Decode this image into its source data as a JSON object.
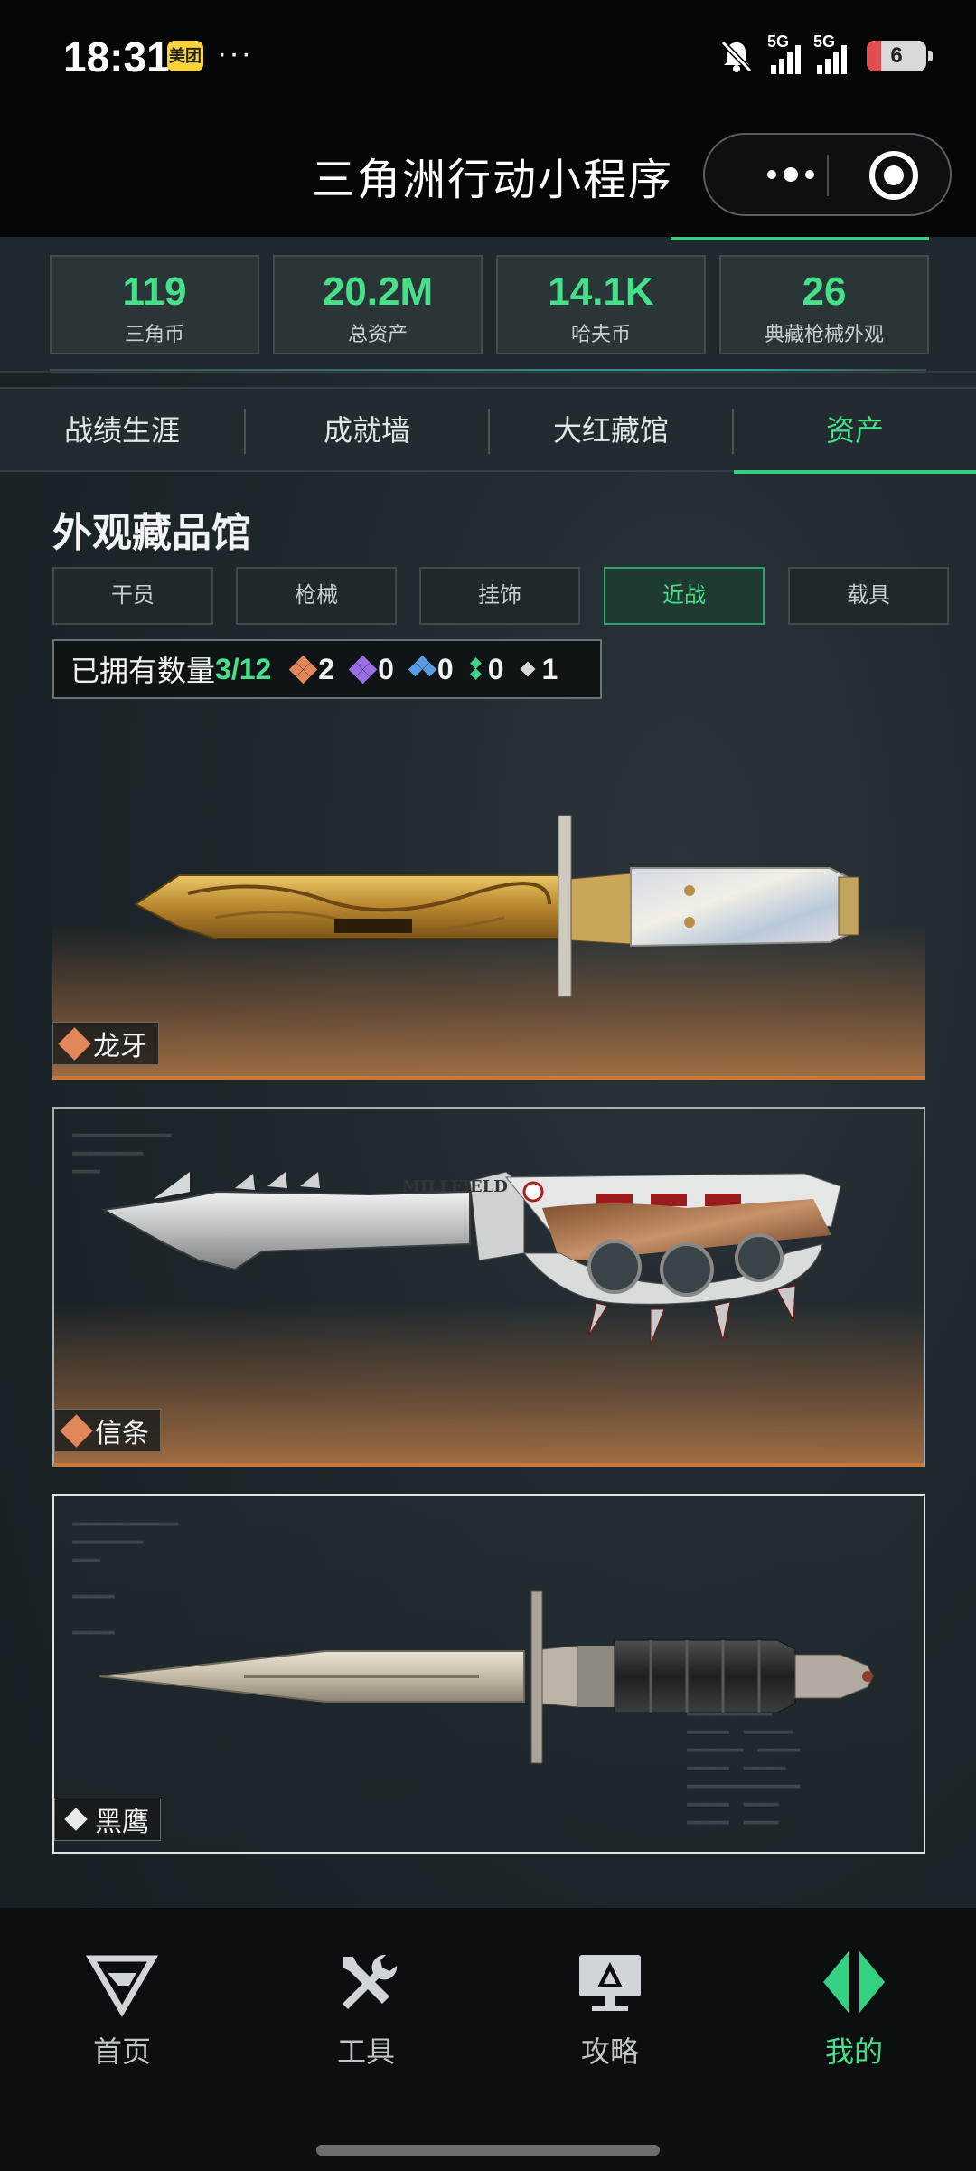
{
  "status_bar": {
    "time": "18:31",
    "app_badge": "美团",
    "more_dots": "···",
    "network_1": "5G",
    "network_2": "5G",
    "battery_level": "6",
    "icons": [
      "mute-bell-icon",
      "signal-icon",
      "battery-icon"
    ]
  },
  "title_bar": {
    "title": "三角洲行动小程序",
    "icons": [
      "more-icon",
      "close-miniprogram-icon"
    ]
  },
  "stats": [
    {
      "value": "119",
      "label": "三角币"
    },
    {
      "value": "20.2M",
      "label": "总资产"
    },
    {
      "value": "14.1K",
      "label": "哈夫币"
    },
    {
      "value": "26",
      "label": "典藏枪械外观"
    }
  ],
  "main_tabs": [
    {
      "label": "战绩生涯",
      "active": false
    },
    {
      "label": "成就墙",
      "active": false
    },
    {
      "label": "大红藏馆",
      "active": false
    },
    {
      "label": "资产",
      "active": true
    }
  ],
  "gallery": {
    "title": "外观藏品馆",
    "categories": [
      {
        "label": "干员",
        "active": false
      },
      {
        "label": "枪械",
        "active": false
      },
      {
        "label": "挂饰",
        "active": false
      },
      {
        "label": "近战",
        "active": true
      },
      {
        "label": "载具",
        "active": false
      }
    ],
    "owned_label": "已拥有数量",
    "owned_count": "3/12",
    "grades": [
      {
        "count": "2",
        "color": "#e1875a",
        "icon": "gold-grade-icon"
      },
      {
        "count": "0",
        "color": "#9b6ee6",
        "icon": "purple-grade-icon"
      },
      {
        "count": "0",
        "color": "#5b9be0",
        "icon": "blue-grade-icon"
      },
      {
        "count": "0",
        "color": "#3fd38a",
        "icon": "green-grade-icon"
      },
      {
        "count": "1",
        "color": "#d8d8d8",
        "icon": "white-grade-icon"
      }
    ],
    "items": [
      {
        "name": "龙牙",
        "rarity": "gold"
      },
      {
        "name": "信条",
        "rarity": "gold"
      },
      {
        "name": "黑鹰",
        "rarity": "white"
      }
    ]
  },
  "bottom_nav": [
    {
      "label": "首页",
      "icon": "delta-logo-icon",
      "active": false
    },
    {
      "label": "工具",
      "icon": "tools-icon",
      "active": false
    },
    {
      "label": "攻略",
      "icon": "guide-monitor-icon",
      "active": false
    },
    {
      "label": "我的",
      "icon": "profile-icon",
      "active": true
    }
  ],
  "colors": {
    "accent_green": "#46e08a",
    "gold_rarity": "#e1875a",
    "background": "#1c2529"
  }
}
